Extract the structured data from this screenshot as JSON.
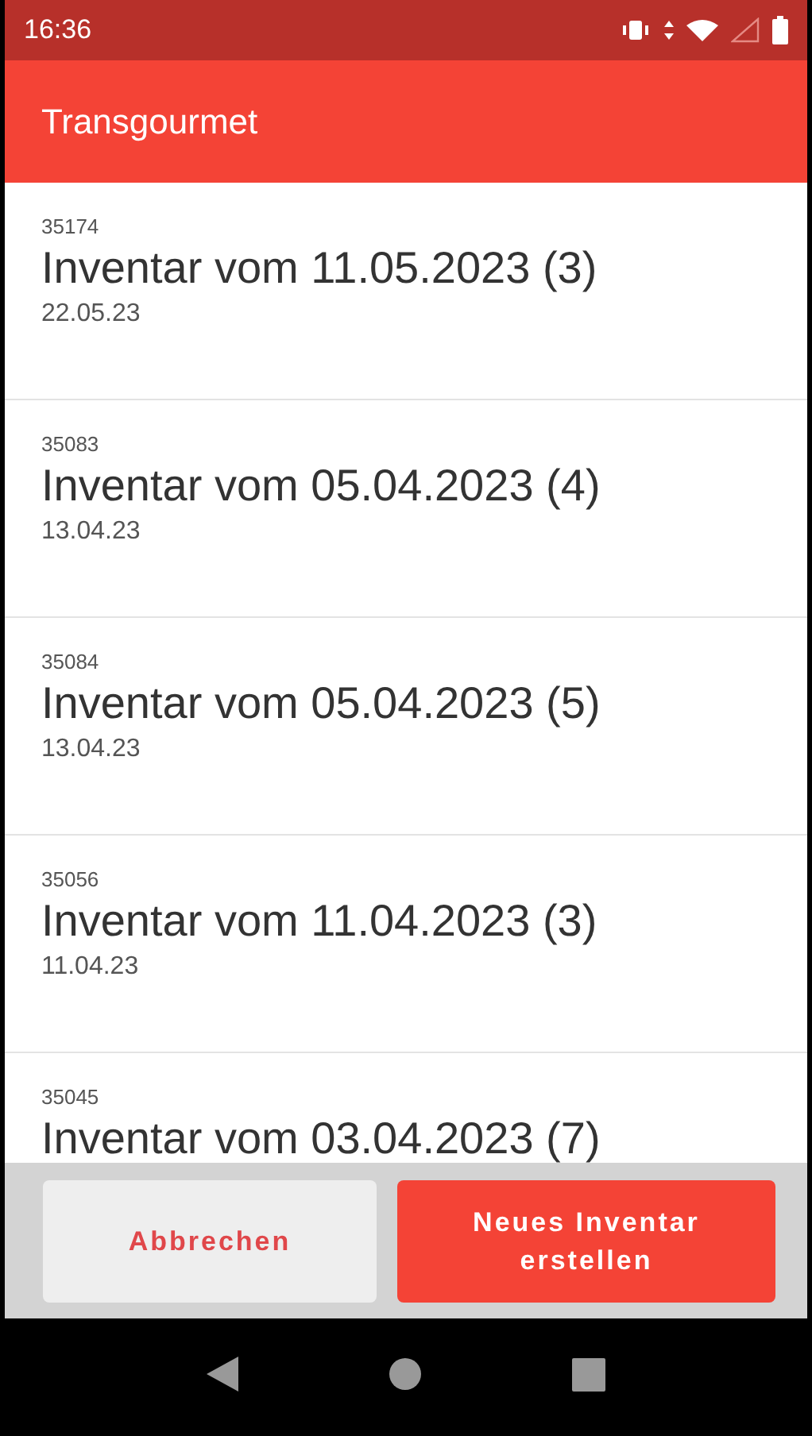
{
  "status_bar": {
    "time": "16:36"
  },
  "app_bar": {
    "title": "Transgourmet"
  },
  "inventories": [
    {
      "number": "35174",
      "title": "Inventar vom 11.05.2023 (3)",
      "date": "22.05.23"
    },
    {
      "number": "35083",
      "title": "Inventar vom 05.04.2023 (4)",
      "date": "13.04.23"
    },
    {
      "number": "35084",
      "title": "Inventar vom 05.04.2023 (5)",
      "date": "13.04.23"
    },
    {
      "number": "35056",
      "title": "Inventar vom 11.04.2023 (3)",
      "date": "11.04.23"
    },
    {
      "number": "35045",
      "title": "Inventar vom 03.04.2023 (7)"
    }
  ],
  "buttons": [
    {
      "label": "Abbrechen",
      "kind": "secondary"
    },
    {
      "label": "Neues Inventar erstellen",
      "kind": "primary"
    }
  ]
}
